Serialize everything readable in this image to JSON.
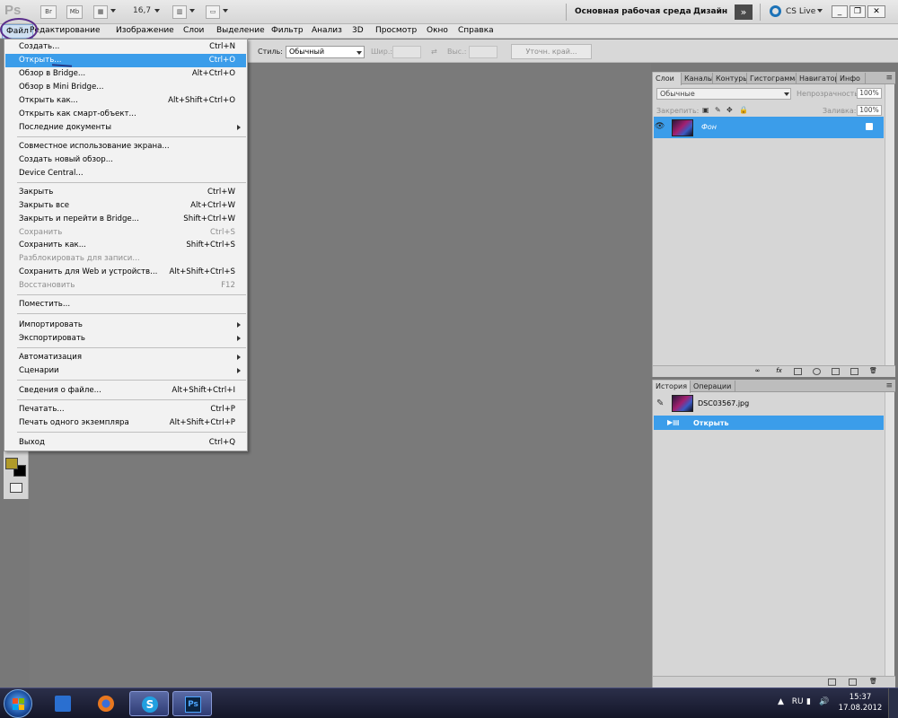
{
  "appbar": {
    "logo": "Ps",
    "bridge_btn": "Br",
    "minibridge_btn": "Mb",
    "zoom": "16,7",
    "workspace": "Основная рабочая среда",
    "design": "Дизайн",
    "cslive": "CS Live"
  },
  "menubar": {
    "items": [
      "Файл",
      "Редактирование",
      "Изображение",
      "Слои",
      "Выделение",
      "Фильтр",
      "Анализ",
      "3D",
      "Просмотр",
      "Окно",
      "Справка"
    ]
  },
  "options": {
    "style_label": "Стиль:",
    "style_value": "Обычный",
    "width_label": "Шир.:",
    "height_label": "Выс.:",
    "refine_btn": "Уточн. край..."
  },
  "file_menu": {
    "items": [
      {
        "label": "Создать...",
        "key": "Ctrl+N"
      },
      {
        "label": "Открыть...",
        "key": "Ctrl+O",
        "highlight": true
      },
      {
        "label": "Обзор в Bridge...",
        "key": "Alt+Ctrl+O"
      },
      {
        "label": "Обзор в Mini Bridge...",
        "key": ""
      },
      {
        "label": "Открыть как...",
        "key": "Alt+Shift+Ctrl+O"
      },
      {
        "label": "Открыть как смарт-объект...",
        "key": ""
      },
      {
        "label": "Последние документы",
        "key": "",
        "submenu": true
      },
      {
        "label": "Совместное использование экрана...",
        "key": ""
      },
      {
        "label": "Создать новый обзор...",
        "key": ""
      },
      {
        "label": "Device Central...",
        "key": ""
      },
      {
        "label": "Закрыть",
        "key": "Ctrl+W"
      },
      {
        "label": "Закрыть все",
        "key": "Alt+Ctrl+W"
      },
      {
        "label": "Закрыть и перейти в Bridge...",
        "key": "Shift+Ctrl+W"
      },
      {
        "label": "Сохранить",
        "key": "Ctrl+S",
        "disabled": true
      },
      {
        "label": "Сохранить как...",
        "key": "Shift+Ctrl+S"
      },
      {
        "label": "Разблокировать для записи...",
        "key": "",
        "disabled": true
      },
      {
        "label": "Сохранить для Web и устройств...",
        "key": "Alt+Shift+Ctrl+S"
      },
      {
        "label": "Восстановить",
        "key": "F12",
        "disabled": true
      },
      {
        "label": "Поместить...",
        "key": ""
      },
      {
        "label": "Импортировать",
        "key": "",
        "submenu": true
      },
      {
        "label": "Экспортировать",
        "key": "",
        "submenu": true
      },
      {
        "label": "Автоматизация",
        "key": "",
        "submenu": true
      },
      {
        "label": "Сценарии",
        "key": "",
        "submenu": true
      },
      {
        "label": "Сведения о файле...",
        "key": "Alt+Shift+Ctrl+I"
      },
      {
        "label": "Печатать...",
        "key": "Ctrl+P"
      },
      {
        "label": "Печать одного экземпляра",
        "key": "Alt+Shift+Ctrl+P"
      },
      {
        "label": "Выход",
        "key": "Ctrl+Q"
      }
    ]
  },
  "layers_panel": {
    "tabs": [
      "Слои",
      "Каналы",
      "Контуры",
      "Гистограмма",
      "Навигатор",
      "Инфо"
    ],
    "blend_mode": "Обычные",
    "opacity_label": "Непрозрачность:",
    "opacity_value": "100%",
    "lock_label": "Закрепить:",
    "fill_label": "Заливка:",
    "fill_value": "100%",
    "layer_name": "Фон"
  },
  "history_panel": {
    "tabs": [
      "История",
      "Операции"
    ],
    "snapshot": "DSC03567.jpg",
    "step": "Открыть"
  },
  "taskbar": {
    "time": "15:37",
    "date": "17.08.2012",
    "tray": "RU"
  },
  "colors": {
    "highlight": "#3b9dea",
    "foreground": "#b09a2a",
    "background": "#000000"
  }
}
